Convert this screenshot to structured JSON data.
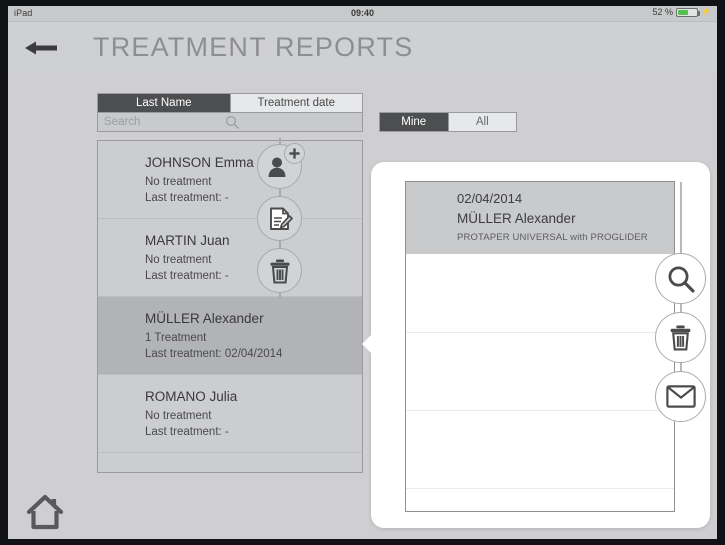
{
  "status_bar": {
    "device": "iPad",
    "time": "09:40",
    "battery_percent": "52 %",
    "battery_icon": "battery-icon",
    "charging_icon": "lightning-bolt-icon"
  },
  "nav": {
    "back_icon": "back-arrow-icon",
    "title": "TREATMENT REPORTS"
  },
  "sort_control": {
    "options": [
      {
        "label": "Last Name",
        "selected": true
      },
      {
        "label": "Treatment date",
        "selected": false
      }
    ]
  },
  "search": {
    "placeholder": "Search",
    "value": "",
    "icon": "search-icon"
  },
  "owner_control": {
    "options": [
      {
        "label": "Mine",
        "selected": true
      },
      {
        "label": "All",
        "selected": false
      }
    ]
  },
  "patients": [
    {
      "name": "JOHNSON Emma",
      "treatments": "No treatment",
      "last_treatment": "Last treatment: -",
      "selected": false
    },
    {
      "name": "MARTIN Juan",
      "treatments": "No treatment",
      "last_treatment": "Last treatment: -",
      "selected": false
    },
    {
      "name": "MÜLLER Alexander",
      "treatments": "1 Treatment",
      "last_treatment": "Last treatment: 02/04/2014",
      "selected": true
    },
    {
      "name": "ROMANO Julia",
      "treatments": "No treatment",
      "last_treatment": "Last treatment: -",
      "selected": false
    }
  ],
  "left_actions": [
    {
      "name": "add-patient-button",
      "icon": "person-plus-icon"
    },
    {
      "name": "edit-report-button",
      "icon": "document-pencil-icon"
    },
    {
      "name": "delete-patient-button",
      "icon": "trash-icon"
    }
  ],
  "popover": {
    "date": "02/04/2014",
    "patient": "MÜLLER Alexander",
    "procedure": "PROTAPER UNIVERSAL with PROGLIDER",
    "body_rows": []
  },
  "right_actions": [
    {
      "name": "inspect-report-button",
      "icon": "magnifier-icon"
    },
    {
      "name": "delete-report-button",
      "icon": "trash-icon"
    },
    {
      "name": "email-report-button",
      "icon": "envelope-icon"
    }
  ],
  "home": {
    "icon": "home-icon"
  },
  "colors": {
    "screen_bg": "#cfcfd1",
    "navbar_bg": "#cfd0d2",
    "segment_active": "#4d4e50",
    "row_selected": "#b2b3b5",
    "battery_green": "#54c14f",
    "title_gray": "#8d8e90"
  }
}
